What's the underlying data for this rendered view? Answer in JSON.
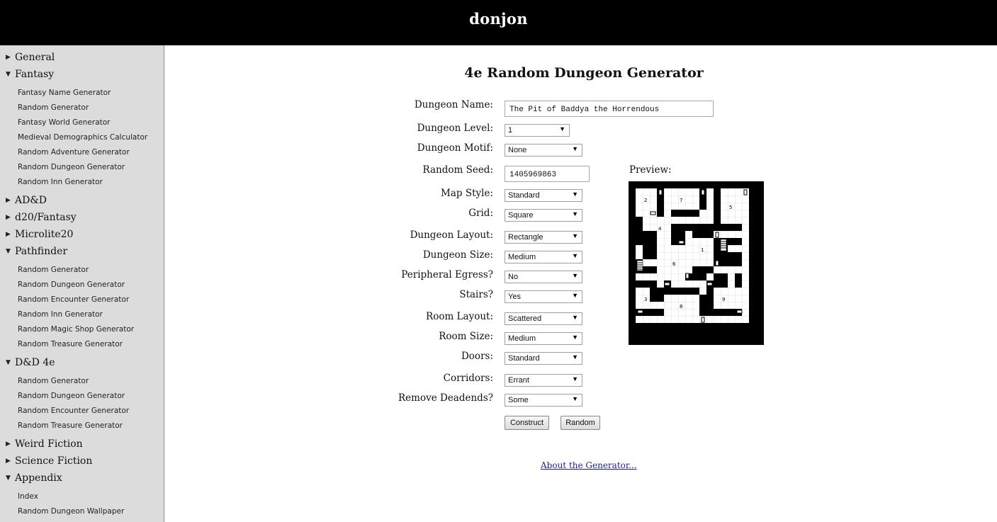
{
  "site": {
    "title": "donjon"
  },
  "sidebar": {
    "groups": [
      {
        "label": "General",
        "expanded": false,
        "items": []
      },
      {
        "label": "Fantasy",
        "expanded": true,
        "items": [
          "Fantasy Name Generator",
          "Random Generator",
          "Fantasy World Generator",
          "Medieval Demographics Calculator",
          "Random Adventure Generator",
          "Random Dungeon Generator",
          "Random Inn Generator"
        ]
      },
      {
        "label": "AD&D",
        "expanded": false,
        "items": []
      },
      {
        "label": "d20/Fantasy",
        "expanded": false,
        "items": []
      },
      {
        "label": "Microlite20",
        "expanded": false,
        "items": []
      },
      {
        "label": "Pathfinder",
        "expanded": true,
        "items": [
          "Random Generator",
          "Random Dungeon Generator",
          "Random Encounter Generator",
          "Random Inn Generator",
          "Random Magic Shop Generator",
          "Random Treasure Generator"
        ]
      },
      {
        "label": "D&D 4e",
        "expanded": true,
        "items": [
          "Random Generator",
          "Random Dungeon Generator",
          "Random Encounter Generator",
          "Random Treasure Generator"
        ]
      },
      {
        "label": "Weird Fiction",
        "expanded": false,
        "items": []
      },
      {
        "label": "Science Fiction",
        "expanded": false,
        "items": []
      },
      {
        "label": "Appendix",
        "expanded": true,
        "items": [
          "Index",
          "Random Dungeon Wallpaper"
        ]
      }
    ]
  },
  "page": {
    "title": "4e Random Dungeon Generator"
  },
  "form": {
    "dungeon_name": {
      "label": "Dungeon Name:",
      "value": "The Pit of Baddya the Horrendous"
    },
    "dungeon_level": {
      "label": "Dungeon Level:",
      "value": "1"
    },
    "dungeon_motif": {
      "label": "Dungeon Motif:",
      "value": "None"
    },
    "random_seed": {
      "label": "Random Seed:",
      "value": "1405969863"
    },
    "map_style": {
      "label": "Map Style:",
      "value": "Standard"
    },
    "grid": {
      "label": "Grid:",
      "value": "Square"
    },
    "dungeon_layout": {
      "label": "Dungeon Layout:",
      "value": "Rectangle"
    },
    "dungeon_size": {
      "label": "Dungeon Size:",
      "value": "Medium"
    },
    "peripheral_egress": {
      "label": "Peripheral Egress?",
      "value": "No"
    },
    "stairs": {
      "label": "Stairs?",
      "value": "Yes"
    },
    "room_layout": {
      "label": "Room Layout:",
      "value": "Scattered"
    },
    "room_size": {
      "label": "Room Size:",
      "value": "Medium"
    },
    "doors": {
      "label": "Doors:",
      "value": "Standard"
    },
    "corridors": {
      "label": "Corridors:",
      "value": "Errant"
    },
    "remove_deadends": {
      "label": "Remove Deadends?",
      "value": "Some"
    },
    "construct_label": "Construct",
    "random_label": "Random"
  },
  "preview": {
    "label": "Preview:",
    "room_numbers": [
      "1",
      "2",
      "3",
      "4",
      "5",
      "6",
      "7",
      "8",
      "9"
    ]
  },
  "footer": {
    "about_link": "About the Generator..."
  },
  "icons": {
    "collapsed": "triangle-right-icon",
    "expanded": "triangle-down-icon",
    "select_arrow": "triangle-down-icon"
  }
}
